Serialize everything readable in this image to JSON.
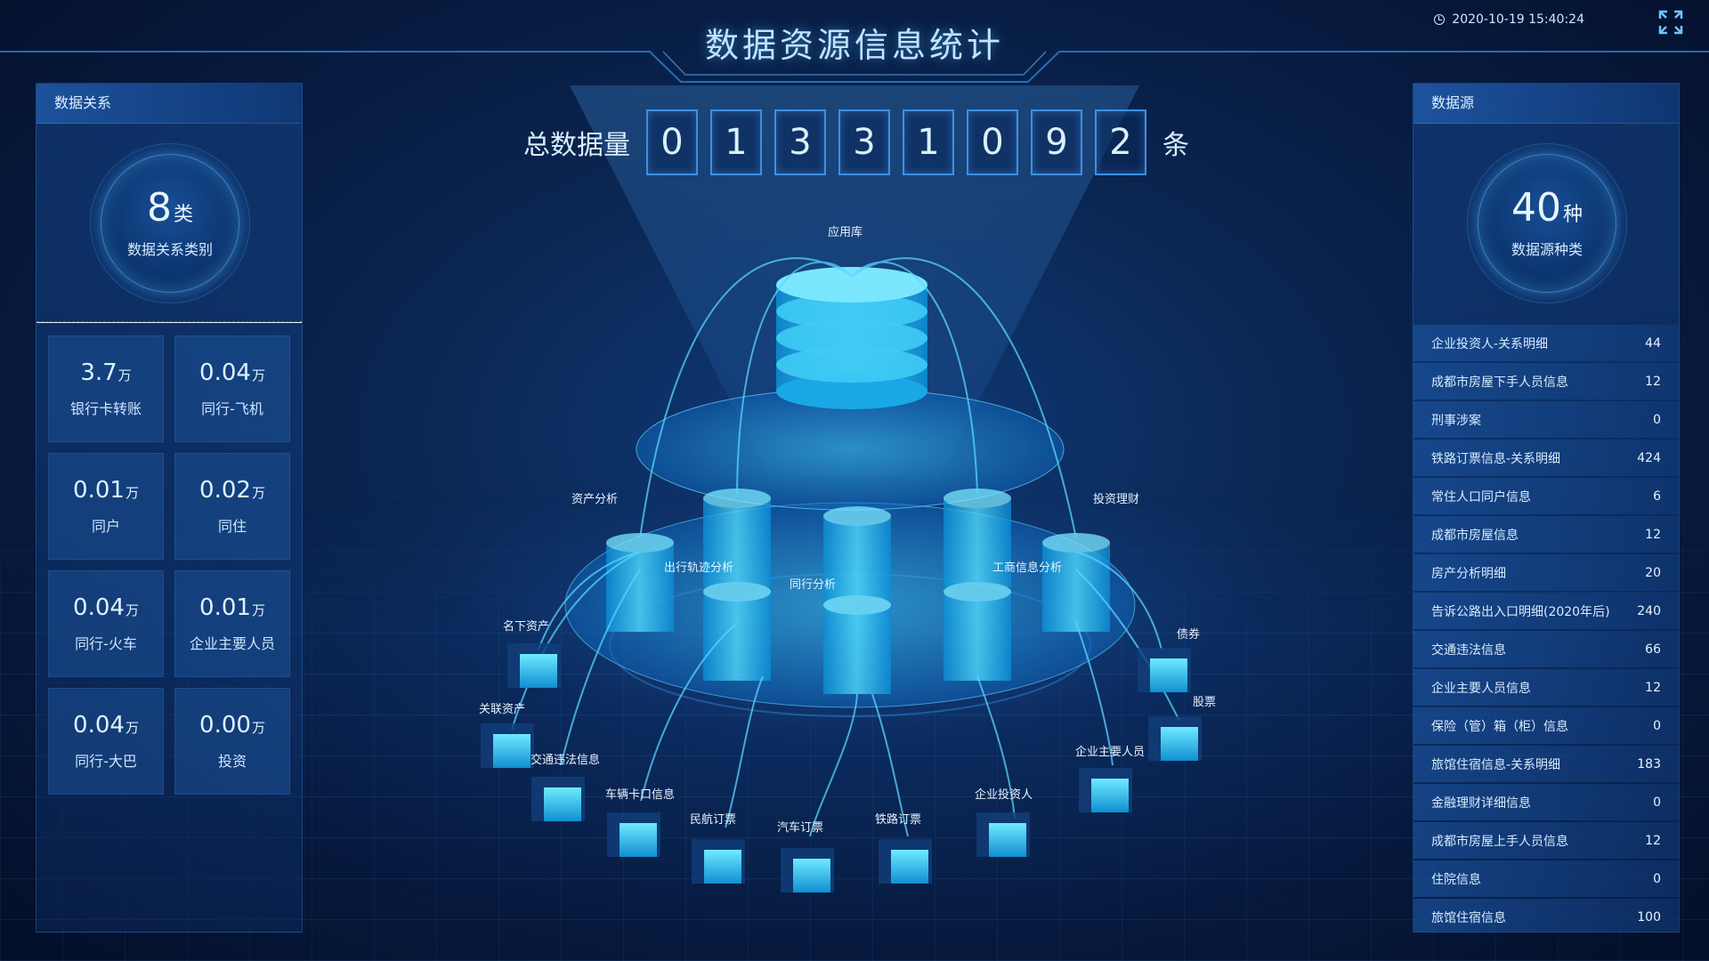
{
  "header": {
    "title": "数据资源信息统计",
    "datetime": "2020-10-19 15:40:24"
  },
  "left_panel": {
    "title": "数据关系",
    "summary": {
      "value": "8",
      "unit": "类",
      "label": "数据关系类别"
    },
    "stats": [
      {
        "value": "3.7",
        "unit": "万",
        "label": "银行卡转账"
      },
      {
        "value": "0.04",
        "unit": "万",
        "label": "同行-飞机"
      },
      {
        "value": "0.01",
        "unit": "万",
        "label": "同户"
      },
      {
        "value": "0.02",
        "unit": "万",
        "label": "同住"
      },
      {
        "value": "0.04",
        "unit": "万",
        "label": "同行-火车"
      },
      {
        "value": "0.01",
        "unit": "万",
        "label": "企业主要人员"
      },
      {
        "value": "0.04",
        "unit": "万",
        "label": "同行-大巴"
      },
      {
        "value": "0.00",
        "unit": "万",
        "label": "投资"
      }
    ]
  },
  "right_panel": {
    "title": "数据源",
    "summary": {
      "value": "40",
      "unit": "种",
      "label": "数据源种类"
    },
    "items": [
      {
        "name": "企业投资人-关系明细",
        "count": "44"
      },
      {
        "name": "成都市房屋下手人员信息",
        "count": "12"
      },
      {
        "name": "刑事涉案",
        "count": "0"
      },
      {
        "name": "铁路订票信息-关系明细",
        "count": "424"
      },
      {
        "name": "常住人口同户信息",
        "count": "6"
      },
      {
        "name": "成都市房屋信息",
        "count": "12"
      },
      {
        "name": "房产分析明细",
        "count": "20"
      },
      {
        "name": "告诉公路出入口明细(2020年后)",
        "count": "240"
      },
      {
        "name": "交通违法信息",
        "count": "66"
      },
      {
        "name": "企业主要人员信息",
        "count": "12"
      },
      {
        "name": "保险（管）箱（柜）信息",
        "count": "0"
      },
      {
        "name": "旅馆住宿信息-关系明细",
        "count": "183"
      },
      {
        "name": "金融理财详细信息",
        "count": "0"
      },
      {
        "name": "成都市房屋上手人员信息",
        "count": "12"
      },
      {
        "name": "住院信息",
        "count": "0"
      },
      {
        "name": "旅馆住宿信息",
        "count": "100"
      }
    ]
  },
  "total": {
    "label": "总数据量",
    "digits": [
      "0",
      "1",
      "3",
      "3",
      "1",
      "0",
      "9",
      "2"
    ],
    "unit": "条"
  },
  "graph": {
    "top_node": "应用库",
    "analysis_nodes": [
      "资产分析",
      "投资理财",
      "出行轨迹分析",
      "工商信息分析",
      "同行分析"
    ],
    "leaf_nodes": [
      "名下资产",
      "关联资产",
      "交通违法信息",
      "车辆卡口信息",
      "民航订票",
      "汽车订票",
      "铁路订票",
      "企业投资人",
      "企业主要人员",
      "股票",
      "债券"
    ]
  },
  "icons": {
    "clock": "clock-icon",
    "fullscreen": "fullscreen-icon"
  },
  "colors": {
    "accent": "#2fb8ff",
    "background": "#0a2550",
    "panel": "#14468c"
  }
}
